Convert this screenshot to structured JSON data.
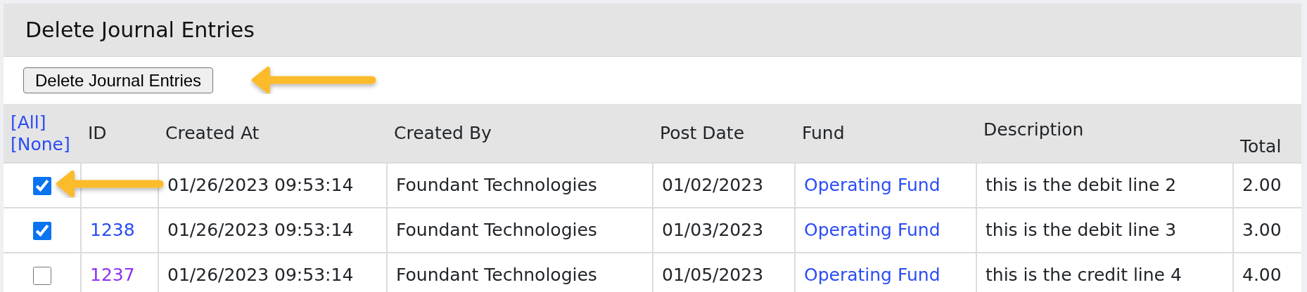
{
  "panel": {
    "title": "Delete Journal Entries"
  },
  "toolbar": {
    "button": "Delete Journal Entries"
  },
  "table": {
    "select_links": [
      "[All]",
      "[None]"
    ],
    "columns": [
      "ID",
      "Created At",
      "Created By",
      "Post Date",
      "Fund",
      "Description",
      "Total"
    ],
    "rows": [
      {
        "selected": true,
        "created_at": "01/26/2023 09:53:14",
        "created_by": "Foundant Technologies",
        "post_date": "01/02/2023",
        "fund": "Operating Fund",
        "description": "this is the debit line 2",
        "total": "2.00"
      },
      {
        "selected": true,
        "id": "1238",
        "visited": false,
        "created_at": "01/26/2023 09:53:14",
        "created_by": "Foundant Technologies",
        "post_date": "01/03/2023",
        "fund": "Operating Fund",
        "description": "this is the debit line 3",
        "total": "3.00"
      },
      {
        "selected": false,
        "id": "1237",
        "visited": true,
        "created_at": "01/26/2023 09:53:14",
        "created_by": "Foundant Technologies",
        "post_date": "01/05/2023",
        "fund": "Operating Fund",
        "description": "this is the credit line 4",
        "total": "4.00"
      }
    ]
  }
}
